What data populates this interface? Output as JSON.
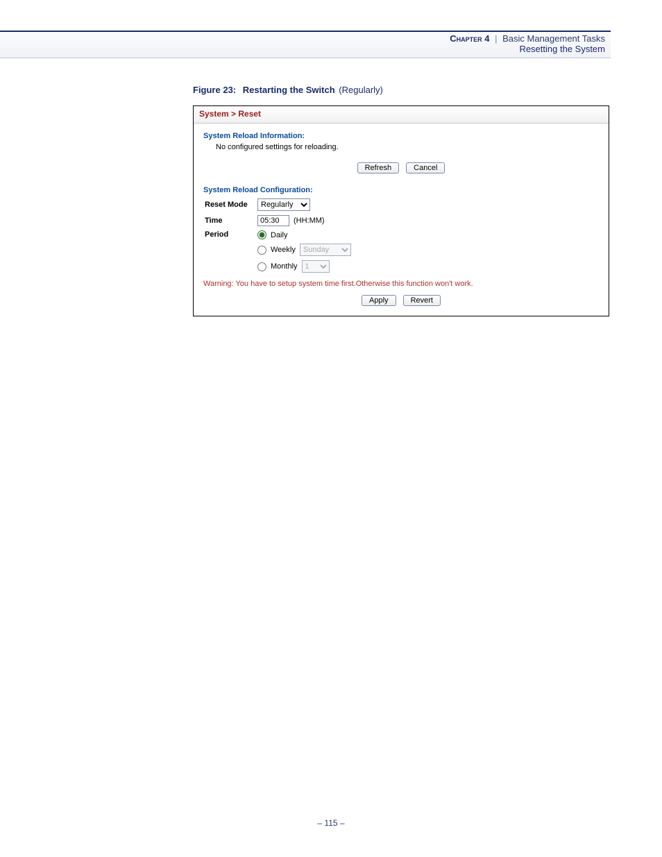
{
  "header": {
    "chapter_label": "Chapter 4",
    "separator": "|",
    "chapter_title": "Basic Management Tasks",
    "subtitle": "Resetting the System"
  },
  "caption": {
    "figure_label": "Figure 23:",
    "figure_title": "Restarting the Switch",
    "figure_qualifier": "(Regularly)"
  },
  "panel": {
    "breadcrumb": "System > Reset",
    "info": {
      "title": "System Reload Information:",
      "text": "No configured settings for reloading."
    },
    "buttons_top": {
      "refresh": "Refresh",
      "cancel": "Cancel"
    },
    "config": {
      "title": "System Reload Configuration:",
      "reset_mode": {
        "label": "Reset Mode",
        "value": "Regularly"
      },
      "time": {
        "label": "Time",
        "value": "05:30",
        "hint": "(HH:MM)"
      },
      "period": {
        "label": "Period",
        "daily_label": "Daily",
        "weekly_label": "Weekly",
        "weekly_value": "Sunday",
        "monthly_label": "Monthly",
        "monthly_value": "1",
        "selected": "daily"
      },
      "warning": "Warning: You have to setup system time first.Otherwise this function won't work."
    },
    "buttons_bottom": {
      "apply": "Apply",
      "revert": "Revert"
    }
  },
  "page_number": "–  115  –"
}
